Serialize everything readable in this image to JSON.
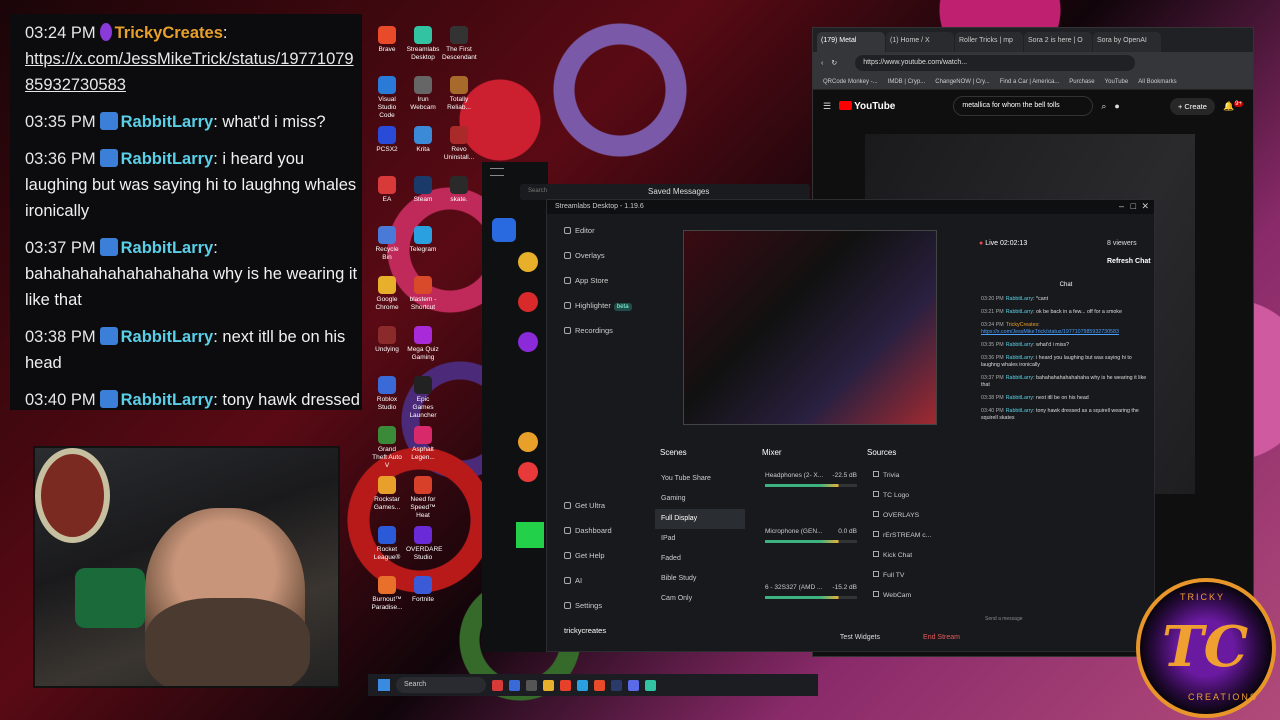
{
  "chat_overlay": {
    "messages": [
      {
        "time": "03:24 PM",
        "user": "TrickyCreates",
        "badge": "purple",
        "text": "",
        "link": "https://x.com/JessMikeTrick/status/1977107985932730583"
      },
      {
        "time": "03:35 PM",
        "user": "RabbitLarry",
        "badge": "blue",
        "text": "what'd i miss?"
      },
      {
        "time": "03:36 PM",
        "user": "RabbitLarry",
        "badge": "blue",
        "text": "i heard you laughing but was saying hi to laughng whales ironically"
      },
      {
        "time": "03:37 PM",
        "user": "RabbitLarry",
        "badge": "blue",
        "text": "bahahahahahahahahaha why is he wearing it like that"
      },
      {
        "time": "03:38 PM",
        "user": "RabbitLarry",
        "badge": "blue",
        "text": "next itll be on his head"
      },
      {
        "time": "03:40 PM",
        "user": "RabbitLarry",
        "badge": "blue",
        "text": "tony hawk dressed as a squirell wearing the squirell skates"
      }
    ]
  },
  "desktop_icons": [
    {
      "label": "Brave",
      "color": "#e84a2a"
    },
    {
      "label": "Streamlabs Desktop",
      "color": "#31c3a2"
    },
    {
      "label": "The First Descendant",
      "color": "#333"
    },
    {
      "label": "Visual Studio Code",
      "color": "#2a7ad8"
    },
    {
      "label": "Irun Webcam",
      "color": "#666"
    },
    {
      "label": "Totally Reliab...",
      "color": "#a86a2a"
    },
    {
      "label": "PCSX2",
      "color": "#2a4ad8"
    },
    {
      "label": "Krita",
      "color": "#3a8ad8"
    },
    {
      "label": "Revo Uninstall...",
      "color": "#aa2a2a"
    },
    {
      "label": "EA",
      "color": "#d83a3a"
    },
    {
      "label": "Steam",
      "color": "#1a3a6a"
    },
    {
      "label": "skate.",
      "color": "#2a2a2a"
    },
    {
      "label": "Recycle Bin",
      "color": "#4a7ad8"
    },
    {
      "label": "Telegram",
      "color": "#2aa0e0"
    },
    {
      "label": "Google Chrome",
      "color": "#e8b02a"
    },
    {
      "label": "blastem - Shortcut",
      "color": "#d84a2a"
    },
    {
      "label": "Undying",
      "color": "#8a2a2a"
    },
    {
      "label": "Mega Quiz Gaming",
      "color": "#a82ad8"
    },
    {
      "label": "Roblox Studio",
      "color": "#3a6ad8"
    },
    {
      "label": "Epic Games Launcher",
      "color": "#222"
    },
    {
      "label": "Grand Theft Auto V",
      "color": "#3a8a3a"
    },
    {
      "label": "Asphalt Legen...",
      "color": "#d82a6a"
    },
    {
      "label": "Rockstar Games...",
      "color": "#e8a02a"
    },
    {
      "label": "Need for Speed™ Heat",
      "color": "#d8402a"
    },
    {
      "label": "Rocket League®",
      "color": "#2a5ad8"
    },
    {
      "label": "OVERDARE Studio",
      "color": "#6a2ad8"
    },
    {
      "label": "Burnout™ Paradise...",
      "color": "#e8702a"
    },
    {
      "label": "Fortnite",
      "color": "#3a5ad8"
    }
  ],
  "youtube": {
    "tabs": [
      "(179) Metal",
      "(1) Home / X",
      "Roller Tricks | mp",
      "Sora 2 is here | O",
      "Sora by OpenAI"
    ],
    "url": "https://www.youtube.com/watch...",
    "bookmarks": [
      "QRCode Monkey -...",
      "IMDB | Cryp...",
      "ChangeNOW | Cry...",
      "Find a Car | America...",
      "Purchase",
      "YouTube",
      "All Bookmarks"
    ],
    "logo": "YouTube",
    "search": "metallica for whom the bell tolls",
    "create": "+ Create",
    "notif": "9+"
  },
  "streamlabs": {
    "search_placeholder": "Search",
    "saved_messages": "Saved Messages",
    "title": "Streamlabs Desktop - 1.19.6",
    "nav": [
      "Editor",
      "Overlays",
      "App Store",
      "Highlighter",
      "Recordings"
    ],
    "beta": "beta",
    "nav_bottom": [
      "Get Ultra",
      "Dashboard",
      "Get Help",
      "AI",
      "Settings"
    ],
    "user": "trickycreates",
    "scenes_label": "Scenes",
    "scenes": [
      "You Tube Share",
      "Gaming",
      "Full Display",
      "IPad",
      "Faded",
      "Bible Study",
      "Cam Only"
    ],
    "selected_scene": "Full Display",
    "mixer_label": "Mixer",
    "mixer": [
      {
        "name": "Headphones (2- X...",
        "db": "-22.5 dB"
      },
      {
        "name": "Microphone (GEN...",
        "db": "0.0 dB"
      },
      {
        "name": "6 - 32S327 (AMD ...",
        "db": "-15.2 dB"
      }
    ],
    "sources_label": "Sources",
    "sources": [
      "Trivia",
      "TC Logo",
      "OVERLAYS",
      "rErSTREAM c...",
      "Kick Chat",
      "Full TV",
      "WebCam"
    ],
    "test_widgets": "Test Widgets",
    "end_stream": "End Stream",
    "live": "Live 02:02:13",
    "viewers": "8 viewers",
    "refresh_chat": "Refresh Chat",
    "chat_label": "Chat",
    "send_placeholder": "Send a message",
    "chat": [
      {
        "time": "03:20 PM",
        "user": "RabbitLarry",
        "text": "*cant"
      },
      {
        "time": "03:21 PM",
        "user": "RabbitLarry",
        "text": "ok be back in a few... off for a smoke"
      },
      {
        "time": "03:24 PM",
        "user": "TrickyCreates",
        "text": "https://x.com/JessMikeTrick/status/1977107985932730583",
        "link": true
      },
      {
        "time": "03:35 PM",
        "user": "RabbitLarry",
        "text": "what'd i miss?"
      },
      {
        "time": "03:36 PM",
        "user": "RabbitLarry",
        "text": "i heard you laughing but was saying hi to laughng whales ironically"
      },
      {
        "time": "03:37 PM",
        "user": "RabbitLarry",
        "text": "bahahahahahahahaha why is he wearing it like that"
      },
      {
        "time": "03:38 PM",
        "user": "RabbitLarry",
        "text": "next itll be on his head"
      },
      {
        "time": "03:40 PM",
        "user": "RabbitLarry",
        "text": "tony hawk dressed as a squirell wearing the squirell skates"
      }
    ]
  },
  "taskbar": {
    "search": "Search"
  },
  "logo": {
    "letters": "TC",
    "top": "TRICKY",
    "bottom": "CREATIONS"
  }
}
